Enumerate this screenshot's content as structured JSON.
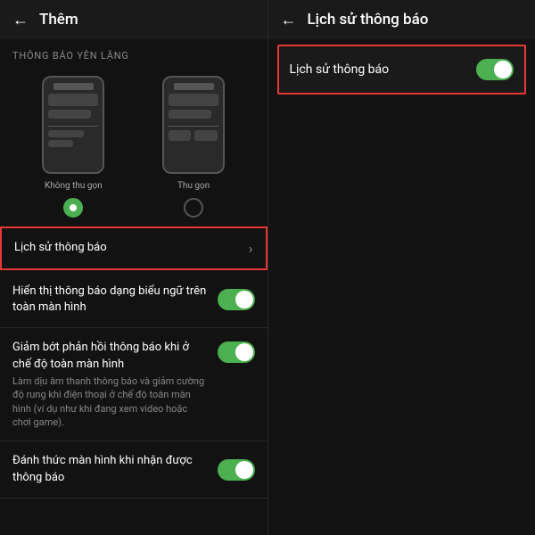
{
  "left_panel": {
    "header": {
      "back_label": "←",
      "title": "Thêm"
    },
    "section_label": "THÔNG BÁO YÊN LẶNG",
    "phone_options": [
      {
        "id": "not-collapsed",
        "label": "Không thu gọn",
        "selected": true
      },
      {
        "id": "collapsed",
        "label": "Thu gọn",
        "selected": false
      }
    ],
    "settings": [
      {
        "id": "lich-su-thong-bao",
        "title": "Lịch sử thông báo",
        "desc": "",
        "type": "nav",
        "highlighted": true
      },
      {
        "id": "hien-thi-bieu-ngu",
        "title": "Hiển thị thông báo dạng biểu ngữ trên toàn màn hình",
        "desc": "",
        "type": "toggle",
        "highlighted": false
      },
      {
        "id": "giam-bot-phan-hoi",
        "title": "Giảm bớt phản hồi thông báo khi ở chế độ toàn màn hình",
        "desc": "Làm dịu âm thanh thông báo và giảm cường độ rung khi điện thoại ở chế độ toàn màn hình (ví dụ như khi đang xem video hoặc chơi game).",
        "type": "toggle",
        "highlighted": false
      },
      {
        "id": "danh-thuc-man-hinh",
        "title": "Đánh thức màn hình khi nhận được thông báo",
        "desc": "",
        "type": "toggle",
        "highlighted": false
      }
    ]
  },
  "right_panel": {
    "header": {
      "back_label": "←",
      "title": "Lịch sử thông báo"
    },
    "highlighted_row": {
      "title": "Lịch sử thông báo",
      "toggle_on": true
    }
  }
}
